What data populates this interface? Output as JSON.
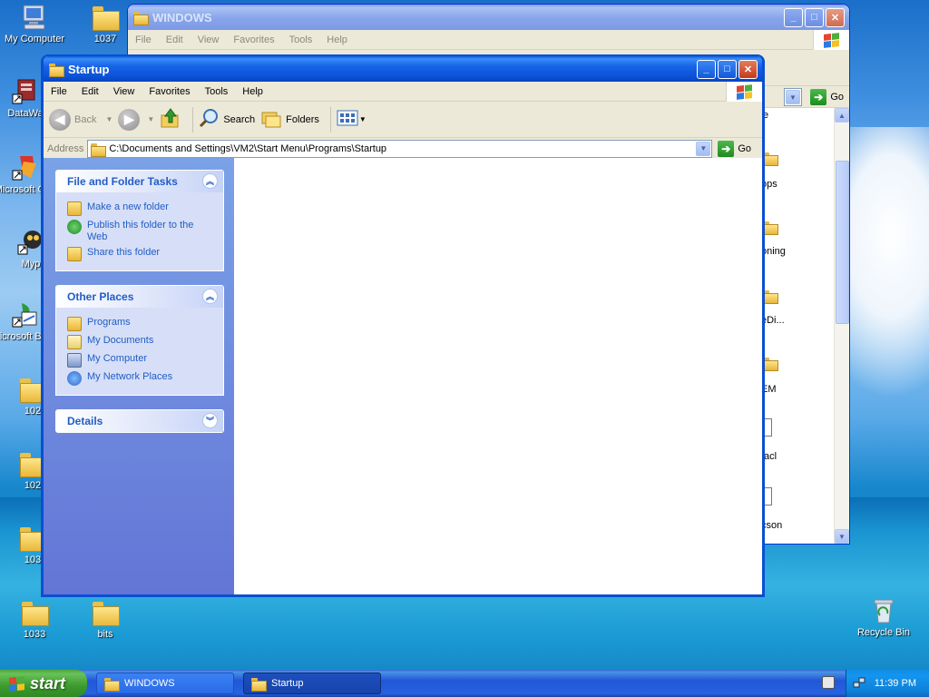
{
  "desktop": {
    "icons": [
      {
        "label": "My Computer"
      },
      {
        "label": "1037"
      },
      {
        "label": "DataWa"
      },
      {
        "label": "Microsoft C++"
      },
      {
        "label": "Myp"
      },
      {
        "label": "Microsoft Basic"
      },
      {
        "label": "102"
      },
      {
        "label": "102"
      },
      {
        "label": "103"
      },
      {
        "label": "1033"
      },
      {
        "label": "bits"
      },
      {
        "label": "Recycle Bin"
      }
    ]
  },
  "windows_window": {
    "title": "WINDOWS",
    "menu": [
      "File",
      "Edit",
      "View",
      "Favorites",
      "Tools",
      "Help"
    ],
    "go_label": "Go",
    "file_labels": [
      "e",
      "ops",
      "oning",
      "eDi...",
      "EM",
      "tacl",
      "cson"
    ]
  },
  "startup_window": {
    "title": "Startup",
    "menu": [
      "File",
      "Edit",
      "View",
      "Favorites",
      "Tools",
      "Help"
    ],
    "toolbar": {
      "back": "Back",
      "search": "Search",
      "folders": "Folders"
    },
    "address_label": "Address",
    "address_value": "C:\\Documents and Settings\\VM2\\Start Menu\\Programs\\Startup",
    "go_label": "Go",
    "tasks": {
      "title": "File and Folder Tasks",
      "items": [
        "Make a new folder",
        "Publish this folder to the Web",
        "Share this folder"
      ]
    },
    "other_places": {
      "title": "Other Places",
      "items": [
        "Programs",
        "My Documents",
        "My Computer",
        "My Network Places"
      ]
    },
    "details": {
      "title": "Details"
    }
  },
  "taskbar": {
    "start_label": "start",
    "tasks": [
      "WINDOWS",
      "Startup"
    ],
    "clock": "11:39 PM"
  },
  "colors": {
    "xp_blue": "#0a5ddc",
    "start_green": "#3c9a2e",
    "taskpane_link": "#215dc6"
  }
}
